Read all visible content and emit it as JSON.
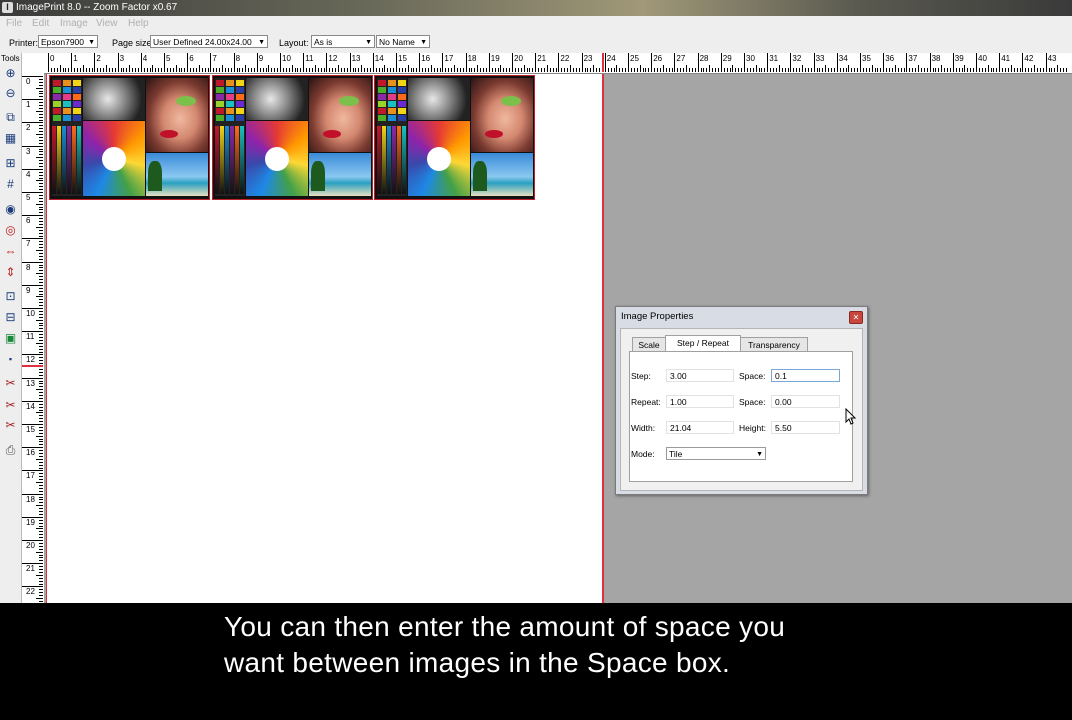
{
  "window": {
    "title": "ImagePrint 8.0 -- Zoom Factor x0.67"
  },
  "menu": [
    "File",
    "Edit",
    "Image",
    "View",
    "Help"
  ],
  "toolbar": {
    "printer_label": "Printer:",
    "printer_value": "Epson7900",
    "pagesize_label": "Page size:",
    "pagesize_value": "User Defined 24.00x24.00",
    "layout_label": "Layout:",
    "layout_value": "As is",
    "name_value": "No Name"
  },
  "tools_label": "Tools",
  "ruler": {
    "h_labels": [
      "0",
      "1",
      "2",
      "3",
      "4",
      "5",
      "6",
      "7",
      "8",
      "9",
      "10",
      "11",
      "12",
      "13",
      "14",
      "15",
      "16",
      "17",
      "18",
      "19",
      "20",
      "21",
      "22",
      "23",
      "24",
      "25",
      "26",
      "27",
      "28",
      "29",
      "30",
      "31",
      "32",
      "33",
      "34",
      "35",
      "36",
      "37",
      "38",
      "39",
      "40",
      "41",
      "42",
      "43"
    ],
    "v_labels": [
      "0",
      "1",
      "2",
      "3",
      "4",
      "5",
      "6",
      "7",
      "8",
      "9",
      "10",
      "11",
      "12",
      "13",
      "14",
      "15",
      "16",
      "17",
      "18",
      "19",
      "20",
      "21",
      "22"
    ]
  },
  "dialog": {
    "title": "Image Properties",
    "tabs": [
      "Scale",
      "Step / Repeat",
      "Transparency"
    ],
    "active_tab": "Step / Repeat",
    "step_label": "Step:",
    "step_value": "3.00",
    "space1_label": "Space:",
    "space1_value": "0.1",
    "repeat_label": "Repeat:",
    "repeat_value": "1.00",
    "space2_label": "Space:",
    "space2_value": "0.00",
    "width_label": "Width:",
    "width_value": "21.04",
    "height_label": "Height:",
    "height_value": "5.50",
    "mode_label": "Mode:",
    "mode_value": "Tile"
  },
  "caption": {
    "line1": "You can then enter the amount of space you",
    "line2": "want between images in the Space box."
  },
  "colors": {
    "margin_red": "#e03040",
    "workspace_gray": "#a5a5a5"
  },
  "tile_count": 3
}
